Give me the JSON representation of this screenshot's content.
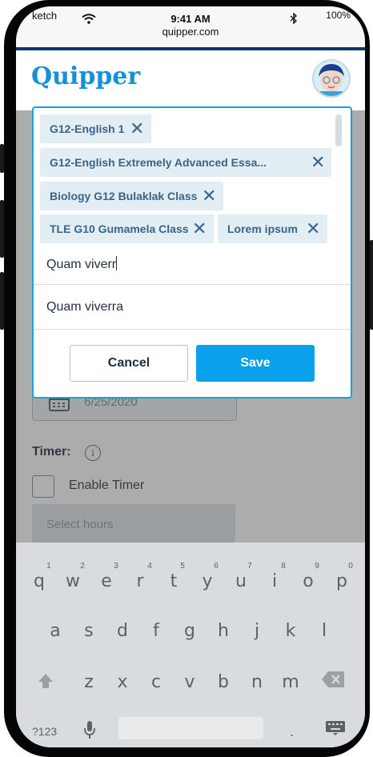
{
  "status_bar": {
    "carrier": "ketch",
    "time": "9:41 AM",
    "url": "quipper.com",
    "battery": "100%"
  },
  "header": {
    "logo": "Quipper",
    "avatar_icon": "user-avatar-icon"
  },
  "background_form": {
    "date_value": "6/25/2020",
    "timer_label": "Timer:",
    "info_icon": "i",
    "enable_timer_label": "Enable Timer",
    "hours_placeholder": "Select hours"
  },
  "modal": {
    "chips": [
      {
        "label": "G12-English 1"
      },
      {
        "label": "G12-English Extremely Advanced Essa..."
      },
      {
        "label": "Biology G12 Bulaklak Class"
      },
      {
        "label": "TLE G10 Gumamela Class"
      },
      {
        "label": "Lorem ipsum"
      }
    ],
    "input_value": "Quam viverr",
    "suggestion": "Quam viverra",
    "cancel_label": "Cancel",
    "save_label": "Save"
  },
  "keyboard": {
    "row1": [
      "q",
      "w",
      "e",
      "r",
      "t",
      "y",
      "u",
      "i",
      "o",
      "p"
    ],
    "row1_numbers": [
      "1",
      "2",
      "3",
      "4",
      "5",
      "6",
      "7",
      "8",
      "9",
      "0"
    ],
    "row2": [
      "a",
      "s",
      "d",
      "f",
      "g",
      "h",
      "j",
      "k",
      "l"
    ],
    "row3": [
      "z",
      "x",
      "c",
      "v",
      "b",
      "n",
      "m"
    ],
    "numbers_key": "?123",
    "period_key": "."
  },
  "colors": {
    "brand": "#1592d5",
    "primary_button": "#0aa0ec",
    "chip_bg": "#e3edf4",
    "chip_text": "#3b6485"
  }
}
